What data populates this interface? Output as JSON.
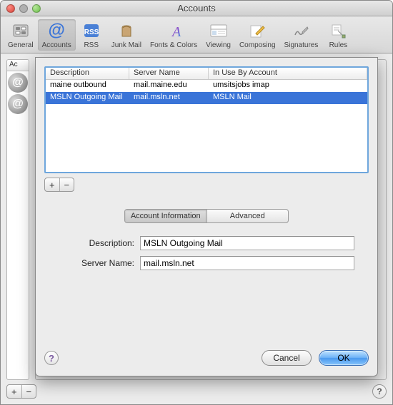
{
  "window": {
    "title": "Accounts"
  },
  "toolbar": {
    "items": [
      {
        "label": "General"
      },
      {
        "label": "Accounts"
      },
      {
        "label": "RSS"
      },
      {
        "label": "Junk Mail"
      },
      {
        "label": "Fonts & Colors"
      },
      {
        "label": "Viewing"
      },
      {
        "label": "Composing"
      },
      {
        "label": "Signatures"
      },
      {
        "label": "Rules"
      }
    ]
  },
  "back": {
    "sidebar_header": "Ac"
  },
  "sheet": {
    "table": {
      "headers": {
        "description": "Description",
        "server_name": "Server Name",
        "in_use_by": "In Use By Account"
      },
      "rows": [
        {
          "description": "maine outbound",
          "server_name": "mail.maine.edu",
          "in_use_by": "umsitsjobs imap"
        },
        {
          "description": "MSLN Outgoing Mail",
          "server_name": "mail.msln.net",
          "in_use_by": "MSLN Mail"
        }
      ]
    },
    "tabs": {
      "account_info": "Account Information",
      "advanced": "Advanced"
    },
    "form": {
      "description_label": "Description:",
      "description_value": "MSLN Outgoing Mail",
      "server_name_label": "Server Name:",
      "server_name_value": "mail.msln.net"
    },
    "buttons": {
      "cancel": "Cancel",
      "ok": "OK"
    }
  },
  "glyphs": {
    "plus": "+",
    "minus": "−",
    "help": "?",
    "at": "@"
  }
}
